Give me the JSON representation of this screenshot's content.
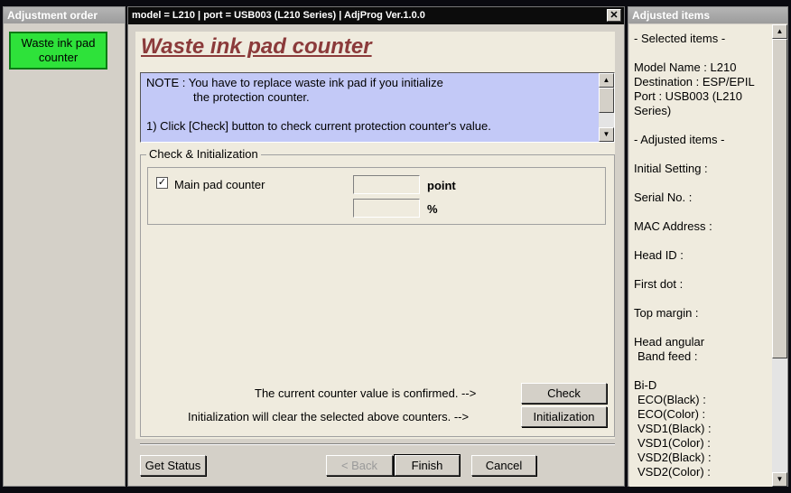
{
  "left_panel": {
    "title": "Adjustment order",
    "button_label": "Waste ink pad counter",
    "button_color": "#2ee23a"
  },
  "window": {
    "title": "model = L210 | port = USB003 (L210 Series) | AdjProg Ver.1.0.0",
    "close_glyph": "✕"
  },
  "page": {
    "title": "Waste ink pad counter",
    "title_color": "#8b3a3a",
    "note_line1": "NOTE : You have to replace waste ink pad if you initialize",
    "note_line2": "the protection counter.",
    "note_line3": "1) Click [Check] button to check current protection counter's value.",
    "note_bg": "#c3c9f7"
  },
  "group": {
    "label": "Check & Initialization",
    "checkbox_checked": true,
    "checkbox_glyph": "✓",
    "checkbox_label": "Main pad counter",
    "point_value": "",
    "percent_value": "",
    "unit_point": "point",
    "unit_percent": "%",
    "check_message": "The current counter value is confirmed. -->",
    "init_message": "Initialization will clear the selected above counters. -->",
    "check_button": "Check",
    "init_button": "Initialization"
  },
  "footer": {
    "get_status": "Get Status",
    "back": "< Back",
    "finish": "Finish",
    "cancel": "Cancel"
  },
  "right_panel": {
    "title": "Adjusted items",
    "selected_header": "- Selected items -",
    "model_name": "Model Name : L210",
    "destination": "Destination : ESP/EPIL",
    "port_line1": "Port : USB003 (L210",
    "port_line2": "Series)",
    "adjusted_header": "- Adjusted items -",
    "initial_setting": "Initial Setting :",
    "serial_no": "Serial No. :",
    "mac_address": "MAC Address :",
    "head_id": "Head ID :",
    "first_dot": "First dot :",
    "top_margin": "Top margin :",
    "head_angular_1": "Head angular",
    "head_angular_2": "Band feed :",
    "bid": "Bi-D",
    "eco_black": "ECO(Black)  :",
    "eco_color": "ECO(Color)  :",
    "vsd1_black": "VSD1(Black) :",
    "vsd1_color": "VSD1(Color) :",
    "vsd2_black": "VSD2(Black) :",
    "vsd2_color": "VSD2(Color) :"
  },
  "icons": {
    "scroll_up": "▲",
    "scroll_down": "▼"
  }
}
